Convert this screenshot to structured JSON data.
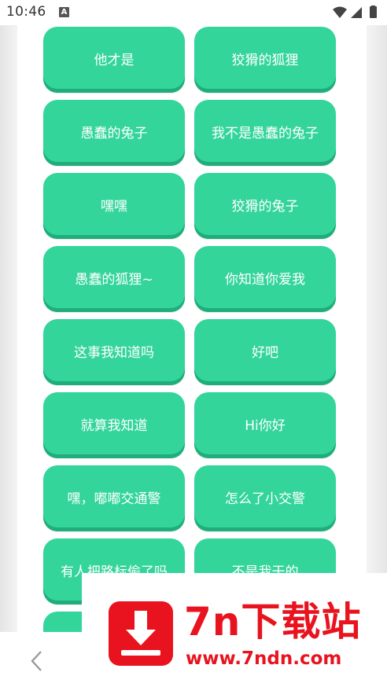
{
  "status_bar": {
    "time": "10:46",
    "notification_letter": "A",
    "icons": [
      "wifi-icon",
      "signal-icon",
      "battery-icon"
    ]
  },
  "tiles": [
    {
      "label": "他才是"
    },
    {
      "label": "狡猾的狐狸"
    },
    {
      "label": "愚蠢的兔子"
    },
    {
      "label": "我不是愚蠢的兔子"
    },
    {
      "label": "嘿嘿"
    },
    {
      "label": "狡猾的兔子"
    },
    {
      "label": "愚蠢的狐狸~"
    },
    {
      "label": "你知道你爱我"
    },
    {
      "label": "这事我知道吗"
    },
    {
      "label": "好吧"
    },
    {
      "label": "就算我知道"
    },
    {
      "label": "Hi你好"
    },
    {
      "label": "嘿，嘟嘟交通警"
    },
    {
      "label": "怎么了小交警"
    },
    {
      "label": "有人把路标偷了吗"
    },
    {
      "label": "不是我干的"
    },
    {
      "label": ""
    },
    {
      "label": ""
    }
  ],
  "bottom_nav": {
    "back_icon": "chevron-left-icon"
  },
  "watermark": {
    "title": "7n下载站",
    "url": "www.7ndn.com",
    "logo_icon": "download-arrow-icon"
  },
  "colors": {
    "tile": "#33d59b",
    "tile_shadow": "#1fae7b",
    "watermark_red": "#e8131e"
  }
}
